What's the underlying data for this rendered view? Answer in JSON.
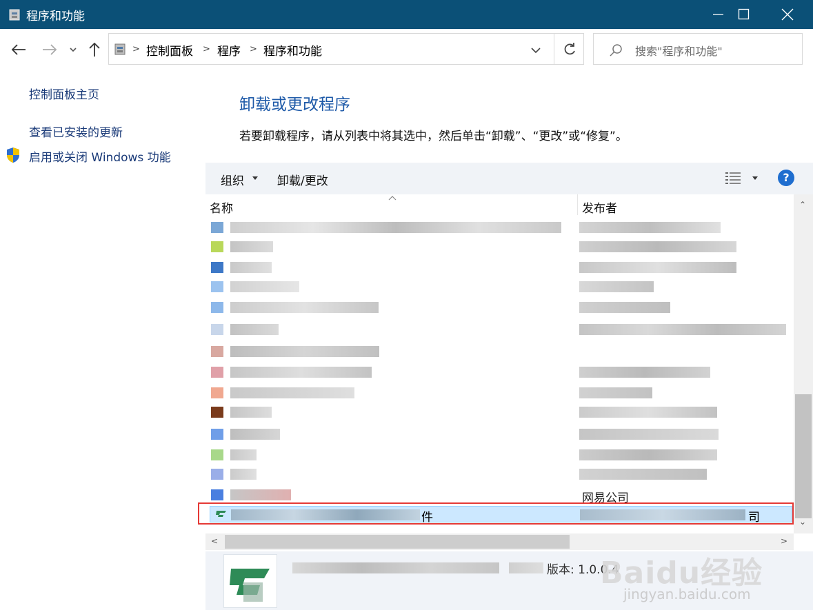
{
  "window": {
    "title": "程序和功能"
  },
  "address": {
    "crumbs": [
      "控制面板",
      "程序",
      "程序和功能"
    ],
    "search_placeholder": "搜索\"程序和功能\""
  },
  "sidebar": {
    "items": [
      {
        "label": "控制面板主页"
      },
      {
        "label": "查看已安装的更新"
      },
      {
        "label": "启用或关闭 Windows 功能"
      }
    ]
  },
  "main": {
    "heading": "卸载或更改程序",
    "description": "若要卸载程序，请从列表中将其选中，然后单击“卸载”、“更改”或“修复”。"
  },
  "toolbar": {
    "organize": "组织",
    "uninstall": "卸载/更改",
    "help": "?"
  },
  "list": {
    "columns": [
      "名称",
      "发布者"
    ],
    "visible_fragments": {
      "row_publisher": "网易公司",
      "selected_name_tail": "件",
      "selected_publisher_tail": "司"
    }
  },
  "details": {
    "version_label": "版本:",
    "version_value": "1.0.0.4"
  },
  "watermark": {
    "main": "Baidu经验",
    "sub": "jingyan.baidu.com"
  },
  "colors": {
    "titlebar": "#0b5077",
    "selection": "#cce8ff",
    "link": "#1a3a78",
    "heading": "#1e5aa8",
    "highlight_box": "#e53935"
  }
}
